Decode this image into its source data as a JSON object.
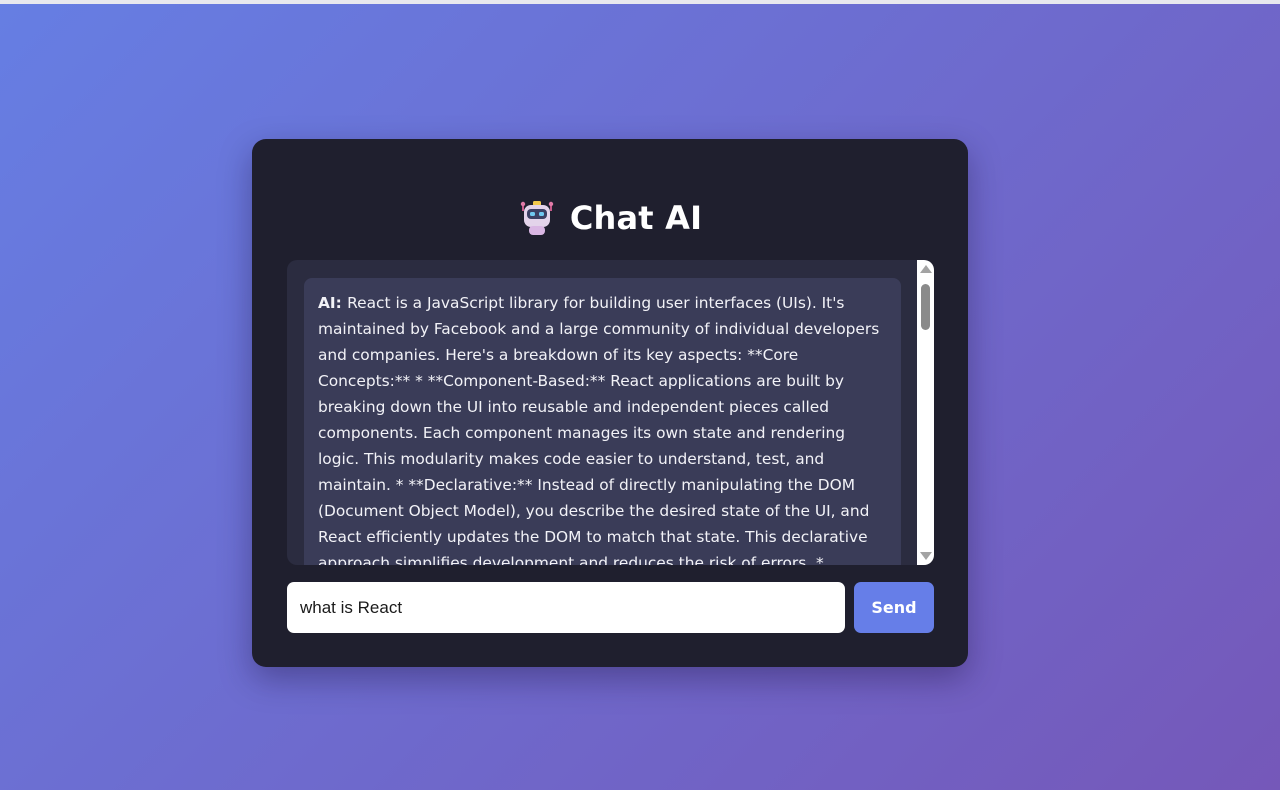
{
  "app": {
    "title": "Chat AI",
    "title_icon": "robot-icon",
    "colors": {
      "background_start": "#667ee3",
      "background_end": "#7558b9",
      "card": "#1f1f2e",
      "panel": "#2b2c40",
      "bubble": "#3a3c58",
      "accent": "#667ee8"
    }
  },
  "messages": [
    {
      "sender": "AI:",
      "text": "React is a JavaScript library for building user interfaces (UIs). It's maintained by Facebook and a large community of individual developers and companies. Here's a breakdown of its key aspects: **Core Concepts:** * **Component-Based:** React applications are built by breaking down the UI into reusable and independent pieces called components. Each component manages its own state and rendering logic. This modularity makes code easier to understand, test, and maintain. * **Declarative:** Instead of directly manipulating the DOM (Document Object Model), you describe the desired state of the UI, and React efficiently updates the DOM to match that state. This declarative approach simplifies development and reduces the risk of errors. * **Virtual DOM:** React uses a virtual DOM"
    }
  ],
  "composer": {
    "input_value": "what is React",
    "send_label": "Send"
  }
}
